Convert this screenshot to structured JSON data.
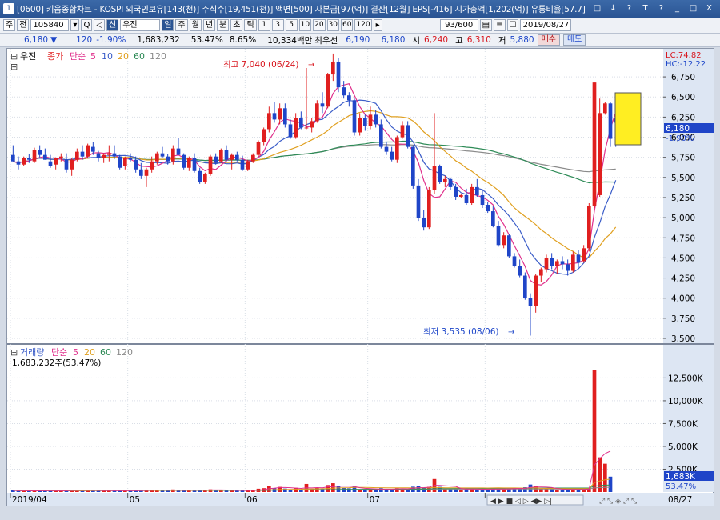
{
  "window": {
    "number": "1",
    "title": "[0600] 키움종합차트 - KOSPI 외국인보유[143(천)] 주식수[19,451(천)] 액면[500] 자본금[97(억)] 결산[12월] EPS[-416] 시가총액[1,202(억)] 유통비율[57.7]",
    "controls": [
      "□",
      "↓",
      "?",
      "T",
      "?",
      "_",
      "□",
      "X"
    ]
  },
  "toolbar": {
    "stock_type": "주",
    "market": "전",
    "code": "105840",
    "name_badge": "신",
    "name": "우진",
    "periods": [
      "일",
      "주",
      "월",
      "년",
      "분",
      "초",
      "틱"
    ],
    "period_selected": "일",
    "minutes": [
      "1",
      "3",
      "5",
      "10",
      "20",
      "30",
      "60",
      "120"
    ],
    "page_count": "93/600",
    "date": "2019/08/27"
  },
  "quote": {
    "price": "6,180",
    "arrow": "▼",
    "change": "120",
    "change_pct": "-1.90%",
    "volume": "1,683,232",
    "vol_ratio": "53.47%",
    "turnover": "8.65%",
    "amount": "10,334백만",
    "priority_label": "최우선",
    "bid": "6,190",
    "ask": "6,180",
    "open_label": "시",
    "open": "6,240",
    "high_label": "고",
    "high": "6,310",
    "low_label": "저",
    "low": "5,880",
    "buy_label": "매수",
    "sell_label": "매도"
  },
  "price_panel": {
    "legend": {
      "name": "우진",
      "close_label": "종가",
      "ma_label": "단순",
      "ma": [
        "5",
        "10",
        "20",
        "60",
        "120"
      ]
    },
    "lc": "LC:74.82",
    "hc": "HC:-12.22",
    "current_price": "6,180",
    "current_pct": "-1.90%",
    "high_annot": "최고 7,040 (06/24)",
    "low_annot": "최저 3,535 (08/06)",
    "y_ticks": [
      "6,750",
      "6,500",
      "6,250",
      "6,000",
      "5,750",
      "5,500",
      "5,250",
      "5,000",
      "4,750",
      "4,500",
      "4,250",
      "4,000",
      "3,750",
      "3,500"
    ]
  },
  "volume_panel": {
    "legend": {
      "name": "거래량",
      "ma_label": "단순",
      "ma": [
        "5",
        "20",
        "60",
        "120"
      ]
    },
    "volume_text": "1,683,232주(53.47%)",
    "y_ticks": [
      "12,500K",
      "10,000K",
      "7,500K",
      "5,000K",
      "2,500K"
    ],
    "current_vol": "1,683K",
    "current_pct": "53.47%"
  },
  "x_axis": {
    "labels": [
      "2019/04",
      "05",
      "06",
      "07",
      "08",
      "08/27"
    ]
  },
  "colors": {
    "up": "#e01f1f",
    "down": "#1f45c8",
    "ma5": "#e0308c",
    "ma10": "#3a5cc8",
    "ma20": "#e0a020",
    "ma60": "#2e8b57",
    "ma120": "#8a8a8a",
    "panel_bg": "#ffffff",
    "axis_bg": "#dde6f3"
  },
  "chart_data": {
    "type": "candlestick",
    "x_range": [
      "2019/04",
      "2019/08/27"
    ],
    "ylim": [
      3500,
      6900
    ],
    "volume_ylim": [
      0,
      13500
    ],
    "candles": [
      [
        5780,
        5900,
        5700,
        5700
      ],
      [
        5700,
        5760,
        5600,
        5660
      ],
      [
        5660,
        5760,
        5640,
        5740
      ],
      [
        5740,
        5790,
        5680,
        5720
      ],
      [
        5700,
        5870,
        5680,
        5840
      ],
      [
        5840,
        5900,
        5750,
        5780
      ],
      [
        5780,
        5860,
        5720,
        5720
      ],
      [
        5700,
        5780,
        5620,
        5640
      ],
      [
        5660,
        5740,
        5600,
        5740
      ],
      [
        5740,
        5800,
        5700,
        5760
      ],
      [
        5720,
        5800,
        5560,
        5600
      ],
      [
        5600,
        5740,
        5520,
        5720
      ],
      [
        5720,
        5860,
        5700,
        5820
      ],
      [
        5820,
        5900,
        5720,
        5760
      ],
      [
        5760,
        5920,
        5740,
        5900
      ],
      [
        5880,
        5940,
        5780,
        5820
      ],
      [
        5800,
        5830,
        5700,
        5740
      ],
      [
        5740,
        5800,
        5680,
        5780
      ],
      [
        5780,
        5900,
        5700,
        5800
      ],
      [
        5800,
        5900,
        5730,
        5760
      ],
      [
        5760,
        5780,
        5600,
        5620
      ],
      [
        5640,
        5760,
        5600,
        5740
      ],
      [
        5740,
        5800,
        5700,
        5720
      ],
      [
        5720,
        5760,
        5560,
        5600
      ],
      [
        5600,
        5680,
        5480,
        5520
      ],
      [
        5520,
        5620,
        5380,
        5600
      ],
      [
        5600,
        5760,
        5560,
        5700
      ],
      [
        5700,
        5820,
        5660,
        5800
      ],
      [
        5800,
        5880,
        5740,
        5760
      ],
      [
        5760,
        5790,
        5660,
        5700
      ],
      [
        5700,
        5900,
        5660,
        5860
      ],
      [
        5860,
        5990,
        5780,
        5780
      ],
      [
        5780,
        5800,
        5600,
        5620
      ],
      [
        5620,
        5760,
        5580,
        5740
      ],
      [
        5740,
        5800,
        5560,
        5580
      ],
      [
        5580,
        5620,
        5420,
        5440
      ],
      [
        5440,
        5560,
        5420,
        5540
      ],
      [
        5540,
        5780,
        5520,
        5760
      ],
      [
        5760,
        5800,
        5660,
        5680
      ],
      [
        5700,
        5860,
        5680,
        5840
      ],
      [
        5840,
        5900,
        5700,
        5720
      ],
      [
        5720,
        5800,
        5600,
        5780
      ],
      [
        5780,
        5820,
        5700,
        5720
      ],
      [
        5720,
        5770,
        5580,
        5600
      ],
      [
        5600,
        5720,
        5580,
        5700
      ],
      [
        5700,
        5800,
        5680,
        5780
      ],
      [
        5780,
        5960,
        5760,
        5940
      ],
      [
        5940,
        6120,
        5900,
        6100
      ],
      [
        6100,
        6380,
        6060,
        6300
      ],
      [
        6300,
        6440,
        6180,
        6220
      ],
      [
        6220,
        6420,
        6160,
        6360
      ],
      [
        6360,
        6420,
        6120,
        6160
      ],
      [
        6160,
        6220,
        5980,
        6000
      ],
      [
        6000,
        6300,
        5980,
        6240
      ],
      [
        6240,
        6320,
        6100,
        6120
      ],
      [
        6120,
        6860,
        6100,
        6120
      ],
      [
        6120,
        6240,
        6060,
        6200
      ],
      [
        6200,
        6460,
        6180,
        6420
      ],
      [
        6420,
        6560,
        6300,
        6380
      ],
      [
        6380,
        6800,
        6360,
        6780
      ],
      [
        6780,
        7040,
        6700,
        6940
      ],
      [
        6940,
        6980,
        6560,
        6620
      ],
      [
        6620,
        6700,
        6480,
        6520
      ],
      [
        6520,
        6560,
        6380,
        6460
      ],
      [
        6460,
        6480,
        6020,
        6060
      ],
      [
        6060,
        6300,
        6020,
        6240
      ],
      [
        6240,
        6280,
        6080,
        6140
      ],
      [
        6140,
        6380,
        6100,
        6280
      ],
      [
        6280,
        6340,
        6120,
        6160
      ],
      [
        6160,
        6220,
        5860,
        5880
      ],
      [
        5880,
        5940,
        5780,
        5820
      ],
      [
        5820,
        5880,
        5700,
        5720
      ],
      [
        5720,
        6020,
        5680,
        6000
      ],
      [
        6000,
        6200,
        5980,
        6150
      ],
      [
        6150,
        6200,
        5860,
        5880
      ],
      [
        5880,
        5900,
        5360,
        5400
      ],
      [
        5400,
        5480,
        4960,
        5000
      ],
      [
        5000,
        5100,
        4840,
        4880
      ],
      [
        4880,
        5380,
        4860,
        5340
      ],
      [
        5340,
        6300,
        5300,
        5640
      ],
      [
        5640,
        5660,
        5420,
        5440
      ],
      [
        5440,
        5520,
        5380,
        5480
      ],
      [
        5480,
        5500,
        5340,
        5380
      ],
      [
        5380,
        5420,
        5220,
        5260
      ],
      [
        5260,
        5300,
        5240,
        5280
      ],
      [
        5280,
        5360,
        5160,
        5180
      ],
      [
        5180,
        5420,
        5160,
        5380
      ],
      [
        5380,
        5480,
        5260,
        5280
      ],
      [
        5280,
        5340,
        5120,
        5160
      ],
      [
        5160,
        5200,
        5060,
        5080
      ],
      [
        5080,
        5140,
        4880,
        4900
      ],
      [
        4900,
        4960,
        4640,
        4660
      ],
      [
        4660,
        4820,
        4620,
        4780
      ],
      [
        4780,
        4800,
        4500,
        4520
      ],
      [
        4520,
        4560,
        4380,
        4400
      ],
      [
        4400,
        4480,
        4260,
        4280
      ],
      [
        4280,
        4320,
        3980,
        4000
      ],
      [
        4000,
        4060,
        3535,
        3900
      ],
      [
        3900,
        4300,
        3820,
        4280
      ],
      [
        4280,
        4380,
        4200,
        4360
      ],
      [
        4360,
        4540,
        4320,
        4500
      ],
      [
        4500,
        4560,
        4360,
        4400
      ],
      [
        4400,
        4480,
        4300,
        4460
      ],
      [
        4460,
        4520,
        4360,
        4420
      ],
      [
        4420,
        4480,
        4280,
        4340
      ],
      [
        4340,
        4580,
        4320,
        4540
      ],
      [
        4540,
        4600,
        4380,
        4440
      ],
      [
        4460,
        4660,
        4440,
        4620
      ],
      [
        4620,
        5180,
        4580,
        5150
      ],
      [
        5150,
        6680,
        5120,
        6680
      ],
      [
        5280,
        6480,
        5260,
        6300
      ],
      [
        6300,
        6440,
        6280,
        6420
      ],
      [
        6420,
        6440,
        5880,
        5980
      ],
      [
        6240,
        6310,
        5880,
        6180
      ]
    ],
    "volumes": [
      180,
      120,
      150,
      110,
      200,
      140,
      130,
      160,
      120,
      140,
      260,
      180,
      220,
      160,
      240,
      170,
      130,
      150,
      190,
      140,
      160,
      170,
      120,
      180,
      210,
      260,
      240,
      220,
      170,
      150,
      280,
      230,
      180,
      200,
      190,
      260,
      210,
      290,
      180,
      220,
      200,
      170,
      150,
      180,
      160,
      210,
      360,
      420,
      690,
      420,
      560,
      380,
      310,
      460,
      280,
      880,
      300,
      470,
      400,
      760,
      960,
      620,
      480,
      400,
      560,
      300,
      280,
      320,
      260,
      420,
      290,
      300,
      420,
      380,
      360,
      580,
      620,
      480,
      560,
      1420,
      560,
      380,
      330,
      360,
      240,
      350,
      390,
      290,
      280,
      260,
      340,
      450,
      300,
      360,
      420,
      380,
      520,
      820,
      640,
      350,
      360,
      300,
      270,
      240,
      230,
      360,
      300,
      280,
      450,
      13400,
      3800,
      3100,
      1683
    ],
    "series": [
      {
        "name": "5"
      },
      {
        "name": "10"
      },
      {
        "name": "20"
      },
      {
        "name": "60"
      },
      {
        "name": "120"
      }
    ]
  }
}
